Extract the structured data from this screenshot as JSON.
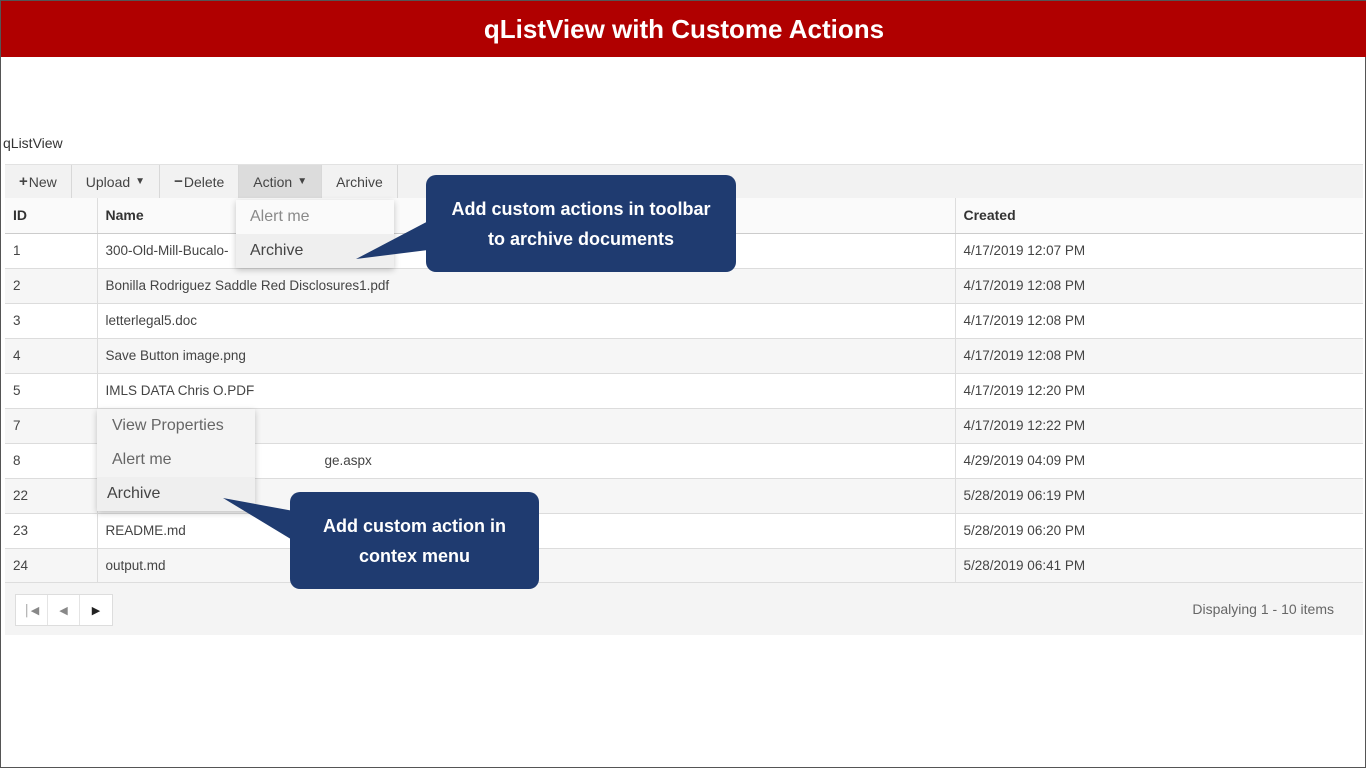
{
  "banner": {
    "title": "qListView with Custome Actions"
  },
  "view": {
    "title": "qListView"
  },
  "toolbar": {
    "new_label": "New",
    "upload_label": "Upload",
    "delete_label": "Delete",
    "action_label": "Action",
    "archive_label": "Archive"
  },
  "action_menu": {
    "items": [
      "Alert me",
      "Archive"
    ]
  },
  "context_menu": {
    "items": [
      "View Properties",
      "Alert me",
      "Archive"
    ]
  },
  "grid": {
    "columns": [
      "ID",
      "Name",
      "Created"
    ],
    "rows": [
      {
        "id": "1",
        "name": "300-Old-Mill-Bucalo-",
        "created": "4/17/2019 12:07 PM"
      },
      {
        "id": "2",
        "name": "Bonilla Rodriguez Saddle Red Disclosures1.pdf",
        "created": "4/17/2019 12:08 PM"
      },
      {
        "id": "3",
        "name": "letterlegal5.doc",
        "created": "4/17/2019 12:08 PM"
      },
      {
        "id": "4",
        "name": "Save Button image.png",
        "created": "4/17/2019 12:08 PM"
      },
      {
        "id": "5",
        "name": "IMLS DATA Chris O.PDF",
        "created": "4/17/2019 12:20 PM"
      },
      {
        "id": "7",
        "name": "",
        "created": "4/17/2019 12:22 PM"
      },
      {
        "id": "8",
        "name": "ge.aspx",
        "created": "4/29/2019 04:09 PM"
      },
      {
        "id": "22",
        "name": "",
        "created": "5/28/2019 06:19 PM"
      },
      {
        "id": "23",
        "name": "README.md",
        "created": "5/28/2019 06:20 PM"
      },
      {
        "id": "24",
        "name": "output.md",
        "created": "5/28/2019 06:41 PM"
      }
    ]
  },
  "pager": {
    "info": "Dispalying 1 - 10 items"
  },
  "callouts": {
    "toolbar_line1": "Add custom actions in toolbar",
    "toolbar_line2": "to archive documents",
    "context_line1": "Add custom action in",
    "context_line2": "contex menu"
  },
  "colors": {
    "banner": "#b00000",
    "callout": "#1f3b70"
  },
  "icons": [
    "plus-icon",
    "caret-down-icon",
    "minus-icon",
    "first-page-icon",
    "prev-page-icon",
    "next-page-icon"
  ]
}
